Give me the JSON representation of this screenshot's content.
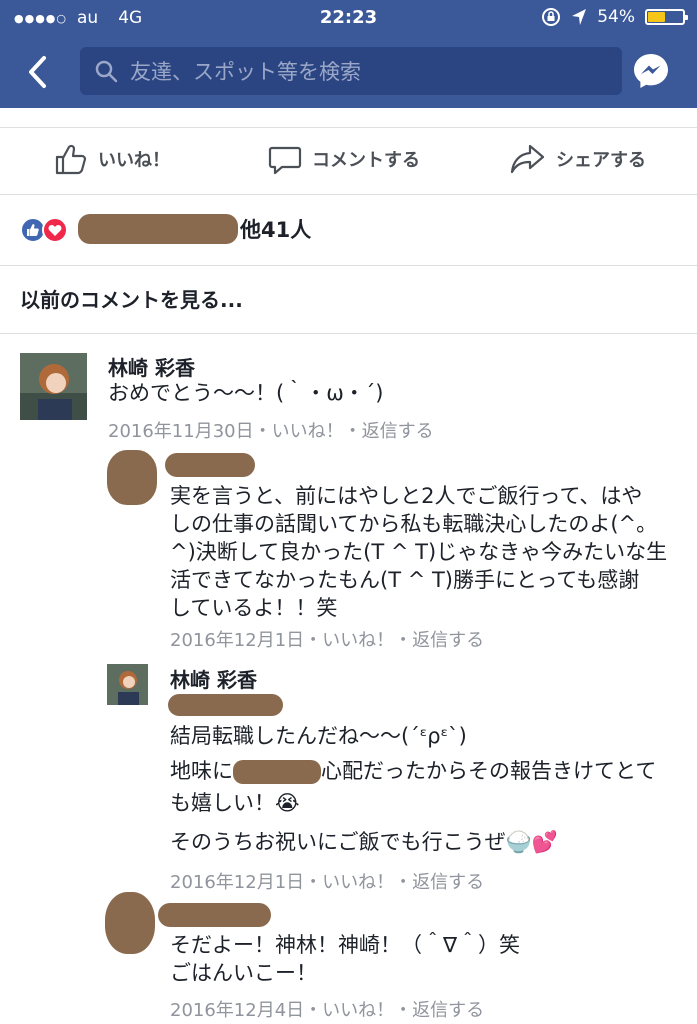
{
  "status": {
    "carrier": "au",
    "network": "4G",
    "time": "22:23",
    "battery": "54%",
    "battery_level": 0.54
  },
  "search": {
    "placeholder": "友達、スポット等を検索"
  },
  "actions": {
    "like": "いいね！",
    "comment": "コメントする",
    "share": "シェアする"
  },
  "reactions": {
    "count_text": "他41人"
  },
  "prev_comments": "以前のコメントを見る...",
  "comments": [
    {
      "name": "林崎 彩香",
      "text": "おめでとう〜〜！(｀・ω・´)",
      "date": "2016年11月30日",
      "like": "いいね！",
      "reply": "返信する"
    },
    {
      "lines": [
        "実を言うと、前にはやしと2人でご飯行って、はや",
        "しの仕事の話聞いてから私も転職決心したのよ(^。",
        "^)決断して良かった(T ^ T)じゃなきゃ今みたいな生",
        "活できてなかったもん(T ^ T)勝手にとっても感謝",
        "しているよ！！笑"
      ],
      "date": "2016年12月1日",
      "like": "いいね！",
      "reply": "返信する"
    },
    {
      "name": "林崎 彩香",
      "line1": "結局転職したんだね〜〜(´ᵋρᵋ`)",
      "line2_a": "地味に",
      "line2_b": "心配だったからその報告きけてとて",
      "line3": "も嬉しい！😭",
      "line4": "そのうちお祝いにご飯でも行こうぜ🍚💕",
      "date": "2016年12月1日",
      "like": "いいね！",
      "reply": "返信する"
    },
    {
      "lines": [
        "そだよー！神林！神崎！（＾∇＾）笑",
        "ごはんいこー！"
      ],
      "date": "2016年12月4日",
      "like": "いいね！",
      "reply": "返信する"
    }
  ],
  "colors": {
    "header": "#3b5998",
    "search_bg": "#2b4582",
    "like_blue": "#4267b2",
    "love_red": "#f0284a",
    "meta_gray": "#90949c"
  }
}
